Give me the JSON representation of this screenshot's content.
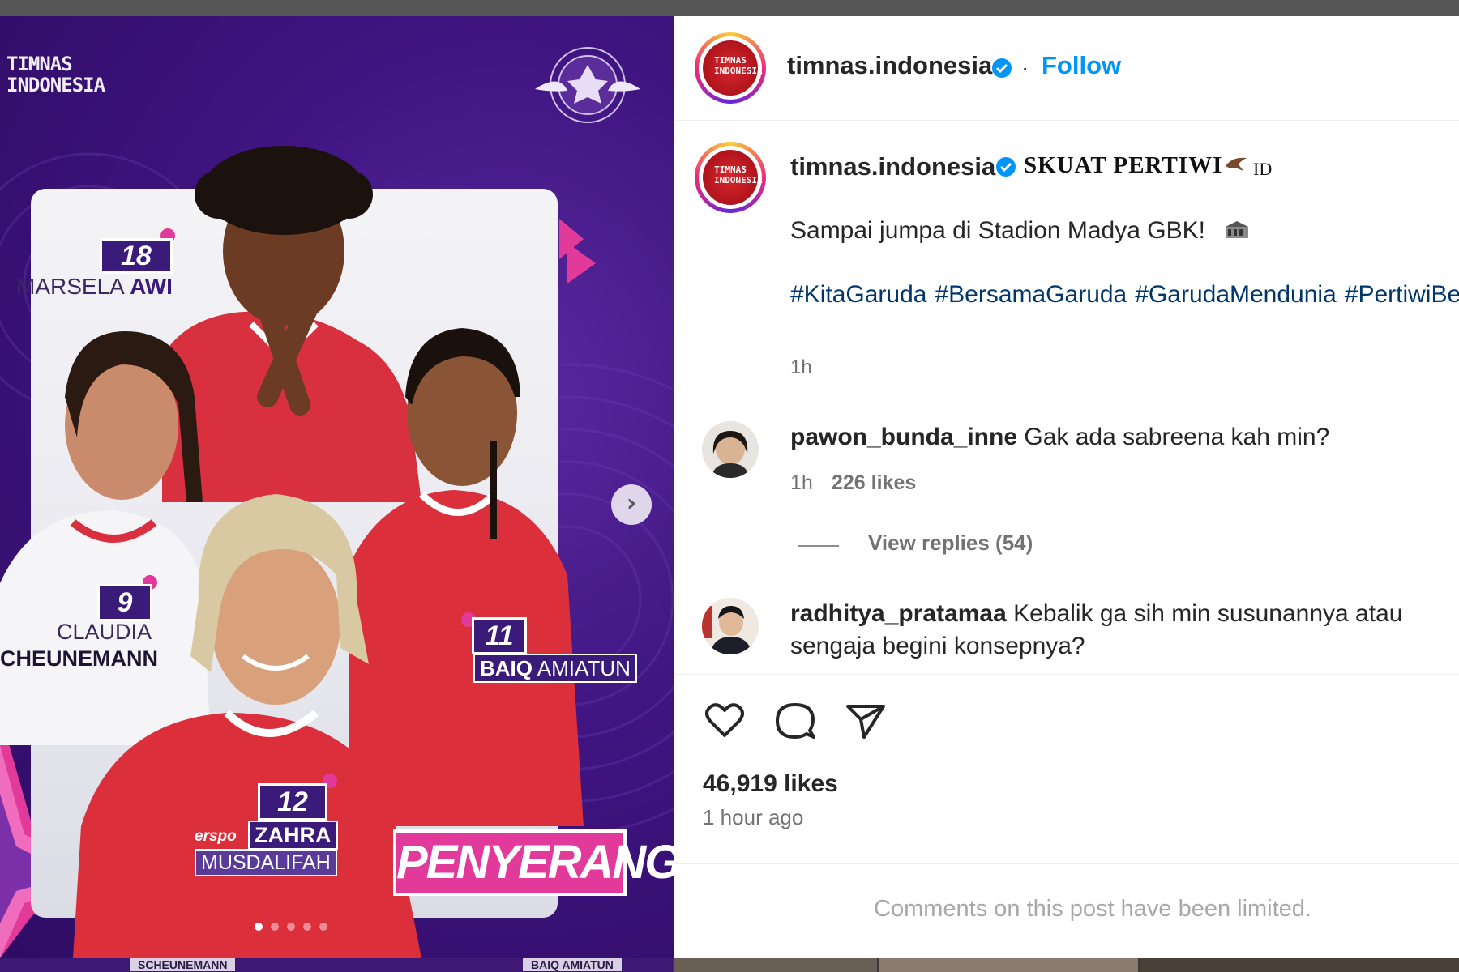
{
  "media": {
    "logo_text": "TIMNAS INDONESIA",
    "role_label": "PENYERANG",
    "carousel_total": 5,
    "carousel_index": 1,
    "players": [
      {
        "number": "18",
        "first": "MARSELA",
        "last": "AWI"
      },
      {
        "number": "9",
        "first": "CLAUDIA",
        "last": "CHEUNEMANN"
      },
      {
        "number": "11",
        "first": "BAIQ",
        "last": "AMIATUN"
      },
      {
        "number": "12",
        "first": "ZAHRA",
        "last": "MUSDALIFAH"
      }
    ],
    "sponsor": "erspo",
    "bottom_strip": [
      "SCHEUNEMANN",
      "BAIQ AMIATUN"
    ]
  },
  "header": {
    "username": "timnas.indonesia",
    "separator": "·",
    "follow_label": "Follow"
  },
  "caption": {
    "username": "timnas.indonesia",
    "title": "SKUAT PERTIWI",
    "flag_suffix": "ID",
    "text": "Sampai jumpa di Stadion Madya GBK!",
    "hashtags": [
      "#KitaGaruda",
      "#BersamaGaruda",
      "#GarudaMendunia",
      "#PertiwiBerani"
    ],
    "time": "1h"
  },
  "comments": [
    {
      "username": "pawon_bunda_inne",
      "text": "Gak ada sabreena kah min?",
      "time": "1h",
      "likes": "226 likes",
      "replies": "View replies (54)"
    },
    {
      "username": "radhitya_pratamaa",
      "text_line1": "Kebalik ga sih min susunannya atau",
      "text_line2": "sengaja begini konsepnya?"
    }
  ],
  "actions": {
    "like": "heart-icon",
    "comment": "comment-icon",
    "share": "share-icon"
  },
  "likes": "46,919 likes",
  "posted": "1 hour ago",
  "limited_notice": "Comments on this post have been limited.",
  "colors": {
    "accent": "#0095f6",
    "hashtag": "#00376b",
    "media_bg": "#3f1480",
    "jersey_red": "#dc2f3c",
    "role_pink": "#e23a9a"
  }
}
